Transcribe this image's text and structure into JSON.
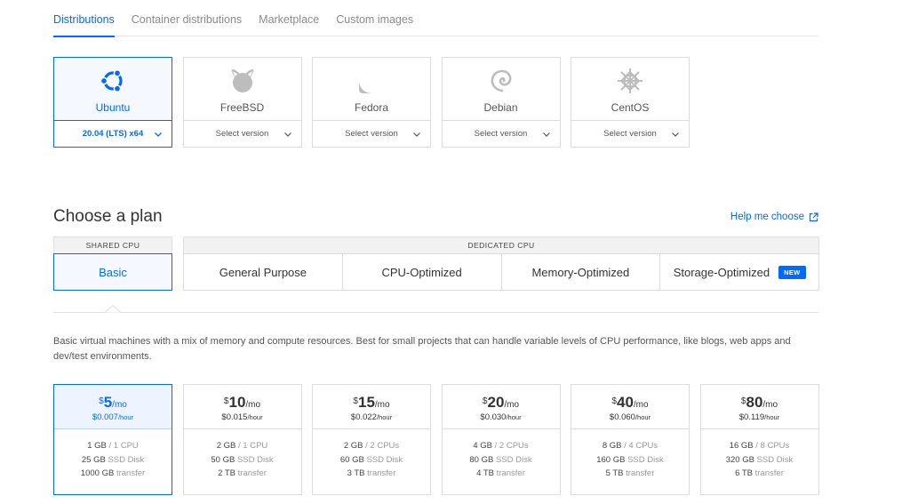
{
  "tabs": [
    "Distributions",
    "Container distributions",
    "Marketplace",
    "Custom images"
  ],
  "distros": [
    {
      "name": "Ubuntu",
      "version": "20.04 (LTS) x64",
      "icon": "ubuntu-icon"
    },
    {
      "name": "FreeBSD",
      "version": "Select version",
      "icon": "freebsd-icon"
    },
    {
      "name": "Fedora",
      "version": "Select version",
      "icon": "fedora-icon"
    },
    {
      "name": "Debian",
      "version": "Select version",
      "icon": "debian-icon"
    },
    {
      "name": "CentOS",
      "version": "Select version",
      "icon": "centos-icon"
    }
  ],
  "plan": {
    "title": "Choose a plan",
    "help": "Help me choose",
    "shared_label": "SHARED CPU",
    "dedicated_label": "DEDICATED CPU",
    "basic": "Basic",
    "dedicated": [
      "General Purpose",
      "CPU-Optimized",
      "Memory-Optimized",
      "Storage-Optimized"
    ],
    "new_badge": "NEW",
    "description": "Basic virtual machines with a mix of memory and compute resources. Best for small projects that can handle variable levels of CPU performance, like blogs, web apps and dev/test environments."
  },
  "prices": [
    {
      "dollar": "$",
      "monthly": "5",
      "mo": "/mo",
      "hourly": "$0.007",
      "hr": "/hour",
      "ram": "1 GB",
      "cpu": "/ 1 CPU",
      "disk": "25 GB",
      "disk_label": "SSD Disk",
      "transfer": "1000 GB",
      "transfer_label": "transfer"
    },
    {
      "dollar": "$",
      "monthly": "10",
      "mo": "/mo",
      "hourly": "$0.015",
      "hr": "/hour",
      "ram": "2 GB",
      "cpu": "/ 1 CPU",
      "disk": "50 GB",
      "disk_label": "SSD Disk",
      "transfer": "2 TB",
      "transfer_label": "transfer"
    },
    {
      "dollar": "$",
      "monthly": "15",
      "mo": "/mo",
      "hourly": "$0.022",
      "hr": "/hour",
      "ram": "2 GB",
      "cpu": "/ 2 CPUs",
      "disk": "60 GB",
      "disk_label": "SSD Disk",
      "transfer": "3 TB",
      "transfer_label": "transfer"
    },
    {
      "dollar": "$",
      "monthly": "20",
      "mo": "/mo",
      "hourly": "$0.030",
      "hr": "/hour",
      "ram": "4 GB",
      "cpu": "/ 2 CPUs",
      "disk": "80 GB",
      "disk_label": "SSD Disk",
      "transfer": "4 TB",
      "transfer_label": "transfer"
    },
    {
      "dollar": "$",
      "monthly": "40",
      "mo": "/mo",
      "hourly": "$0.060",
      "hr": "/hour",
      "ram": "8 GB",
      "cpu": "/ 4 CPUs",
      "disk": "160 GB",
      "disk_label": "SSD Disk",
      "transfer": "5 TB",
      "transfer_label": "transfer"
    },
    {
      "dollar": "$",
      "monthly": "80",
      "mo": "/mo",
      "hourly": "$0.119",
      "hr": "/hour",
      "ram": "16 GB",
      "cpu": "/ 8 CPUs",
      "disk": "320 GB",
      "disk_label": "SSD Disk",
      "transfer": "6 TB",
      "transfer_label": "transfer"
    }
  ],
  "colors": {
    "accent": "#0069ff",
    "border": "#dcdcdc",
    "selected_bg": "#f5f9ff"
  }
}
